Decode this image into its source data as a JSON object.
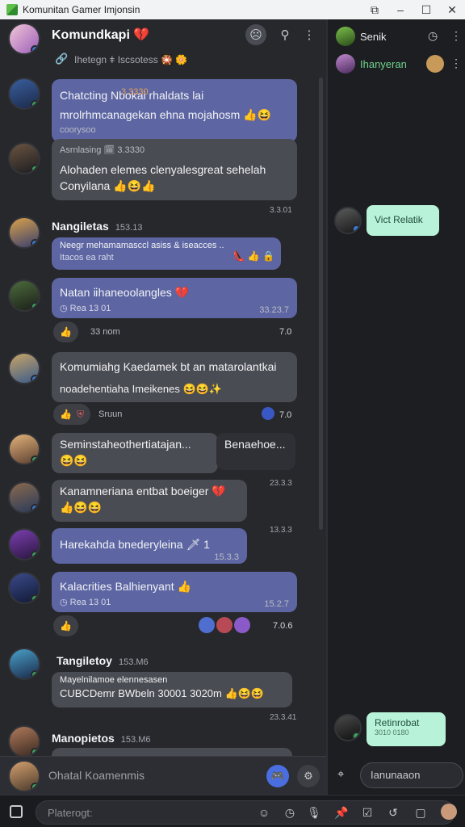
{
  "window": {
    "title": "Komunitan Gamer Imjonsin",
    "controls": [
      "⧉",
      "–",
      "☐",
      "✕"
    ]
  },
  "chat": {
    "header": {
      "name": "Komundkapi 💔",
      "subtitle": "Ihetegn ǂ Iscsotess 🎇 🌼"
    },
    "messages": {
      "m1": {
        "line1": "Chatcting  Nbokai rhaldats lai",
        "tag": "3 3330",
        "line2": "mrolrhmcanagekan ehna mojahosm 👍😆",
        "sub1": "coorysoo",
        "sub2": "Asrnlasing 🗓 3.3330"
      },
      "m2": {
        "text": "Alohaden elemes clenyalesgreat sehelah Conyilana 👍😆👍",
        "time": "3.3.01"
      },
      "m3": {
        "user": "Nangiletas",
        "user_time": "153.13",
        "text": "Neegr mehamamasccl asiss & iseacces ..",
        "sub": "Itacos ea raht",
        "icons": "👠  👍 🔒"
      },
      "m4": {
        "text": "Natan ⅱhaneoolangles 💔",
        "sub": "◷ Rea 13 01",
        "time": "33.23.7",
        "react_count": "33 nom",
        "side_num": "7.0"
      },
      "m5": {
        "text": "Komumiahg Kaedamek bt an matarolantkai",
        "text2": "noadehentiaha Imeikenes 😆😆✨",
        "react": "Sruun",
        "side_num": "7.0"
      },
      "m6": {
        "text": "Seminstaheothertiatajan...",
        "emoji": "😆😆",
        "extra": "Benaehoe...",
        "time": "23.3.3"
      },
      "m7": {
        "text": "Kanamneriana entbat boeiger 💔",
        "emoji": "👍😆😆",
        "time": "13.3.3"
      },
      "m8": {
        "text": "Harekahda bnederyleina 🗡 1",
        "time": "15.3.3"
      },
      "m9": {
        "text": "Kalacrities Balhienyant 👍",
        "sub": "◷ Rea 13 01",
        "time": "15.2.7",
        "react_count": "7 0",
        "side_num": "7.0.6"
      },
      "m10": {
        "user": "Tangiletoy",
        "user_time": "153.M6",
        "line1": "Mayelnilamoe elennesasen",
        "line2": "CUBCDemr BWbeln 30001 3020m 👍😆😆",
        "time": "23.3.41"
      },
      "m11": {
        "user": "Manopietos",
        "user_time": "153.M6"
      }
    },
    "composer_placeholder": "Ohatal Koamenmis"
  },
  "side": {
    "row1": "Senik",
    "row2": "Ihanyeran",
    "bubble1": "Vict Relatik",
    "bubble2_title": "Retinrobat",
    "bubble2_sub": "3010 0180",
    "input_value": "Ianunaaon"
  },
  "bottom": {
    "search_placeholder": "Platerogt:"
  },
  "colors": {
    "bubble_gray": "#4a4c53",
    "bubble_blue": "#5d66a3",
    "accent_green": "#b8f2d8",
    "online": "#3ba55d"
  }
}
